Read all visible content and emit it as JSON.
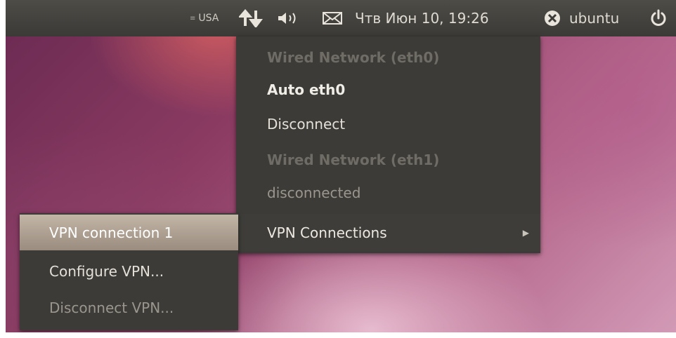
{
  "top_panel": {
    "keyboard_layout": "USA",
    "clock": "Чтв Июн 10, 19:26",
    "username": "ubuntu",
    "icons": [
      "network-updown-icon",
      "volume-icon",
      "mail-icon",
      "user-status-icon",
      "power-icon"
    ]
  },
  "network_menu": {
    "items": [
      {
        "label": "Wired Network (eth0)",
        "kind": "header"
      },
      {
        "label": "Auto eth0",
        "kind": "active-connection"
      },
      {
        "label": "Disconnect",
        "kind": "action"
      },
      {
        "label": "Wired Network (eth1)",
        "kind": "header"
      },
      {
        "label": "disconnected",
        "kind": "disabled"
      },
      {
        "label": "VPN Connections",
        "kind": "submenu"
      }
    ]
  },
  "vpn_submenu": {
    "items": [
      {
        "label": "VPN connection 1",
        "kind": "highlighted"
      },
      {
        "label": "Configure VPN...",
        "kind": "action"
      },
      {
        "label": "Disconnect VPN...",
        "kind": "disabled"
      }
    ]
  },
  "colors": {
    "panel_bg": "#3c3b37",
    "menu_bg": "#3c3b37",
    "highlight": "#b1a596",
    "header_text": "#6f6c66",
    "text": "#e4e0d8"
  }
}
